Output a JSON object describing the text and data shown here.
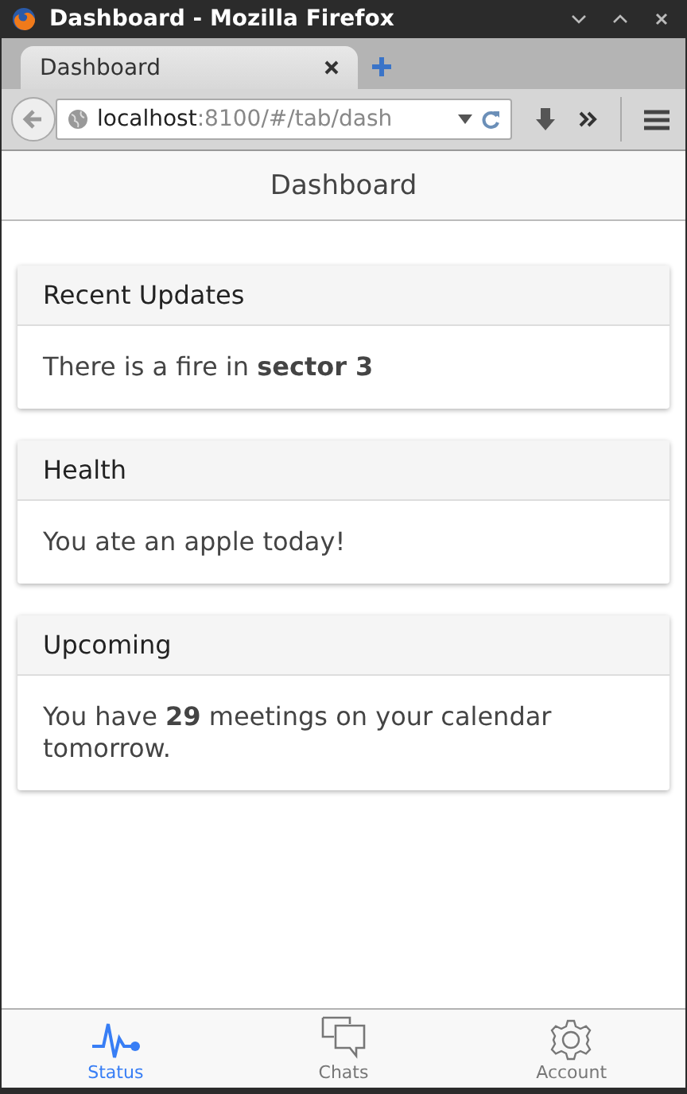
{
  "window": {
    "title": "Dashboard - Mozilla Firefox"
  },
  "browser_tabs": [
    {
      "label": "Dashboard",
      "selected": true
    }
  ],
  "address": {
    "host": "localhost",
    "path": ":8100/#/tab/dash"
  },
  "header": {
    "title": "Dashboard"
  },
  "cards": [
    {
      "title": "Recent Updates",
      "body": "There is a fire in **sector 3**"
    },
    {
      "title": "Health",
      "body": "You ate an apple today!"
    },
    {
      "title": "Upcoming",
      "body": "You have **29** meetings on your calendar tomorrow."
    }
  ],
  "tabs": [
    {
      "label": "Status",
      "kind": "pulse",
      "selected": true
    },
    {
      "label": "Chats",
      "kind": "chats",
      "selected": false
    },
    {
      "label": "Account",
      "kind": "gear",
      "selected": false
    }
  ]
}
